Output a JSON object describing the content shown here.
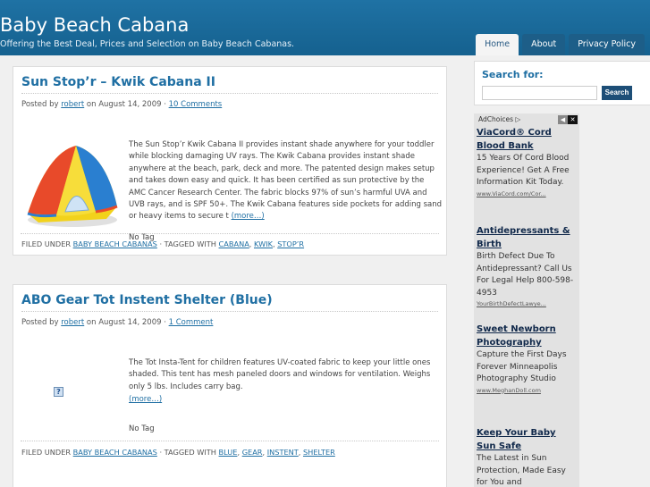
{
  "site": {
    "title": "Baby Beach Cabana",
    "description": "Offering the Best Deal, Prices and Selection on Baby Beach Cabanas."
  },
  "nav": {
    "items": [
      {
        "label": "Home"
      },
      {
        "label": "About"
      },
      {
        "label": "Privacy Policy"
      }
    ]
  },
  "posts": [
    {
      "title": "Sun Stop’r – Kwik Cabana II",
      "posted_by": "Posted by",
      "author": "robert",
      "date": "on August 14, 2009 ·",
      "comments": "10 Comments",
      "body": "The Sun Stop’r Kwik Cabana II provides instant shade anywhere for your toddler while blocking damaging UV rays. The Kwik Cabana provides instant shade anywhere at the beach, park, deck and more. The patented design makes setup and takes down easy and quick. It has been certified as sun protective by the AMC Cancer Research Center. The fabric blocks 97% of sun’s harmful UVA and UVB rays, and is SPF 50+. The Kwik Cabana features side pockets for adding sand or heavy items to secure t",
      "more": "(more…)",
      "no_tag": "No Tag",
      "filed_under": "FILED UNDER",
      "category": "BABY BEACH CABANAS",
      "tagged_with": "· TAGGED WITH",
      "tags": [
        "CABANA",
        "KWIK",
        "STOP’R"
      ]
    },
    {
      "title": "ABO Gear Tot Instent Shelter (Blue)",
      "posted_by": "Posted by",
      "author": "robert",
      "date": "on August 14, 2009 ·",
      "comments": "1 Comment",
      "body": "The Tot Insta-Tent for children features UV-coated fabric to keep your little ones shaded.  This tent has mesh paneled doors and windows for ventilation. Weighs only 5 lbs. Includes carry bag.",
      "more": "(more…)",
      "no_tag": "No Tag",
      "filed_under": "FILED UNDER",
      "category": "BABY BEACH CABANAS",
      "tagged_with": "· TAGGED WITH",
      "tags": [
        "BLUE",
        "GEAR",
        "INSTENT",
        "SHELTER"
      ]
    }
  ],
  "sidebar": {
    "search_label": "Search for:",
    "search_value": "",
    "search_button": "Search",
    "adchoices": "AdChoices",
    "ads": [
      {
        "title": "ViaCord® Cord Blood Bank",
        "text": "15 Years Of Cord Blood Experience! Get A Free Information Kit Today.",
        "url": "www.ViaCord.com/Cor..."
      },
      {
        "title": "Antidepressants & Birth",
        "text": "Birth Defect Due To Antidepressant? Call Us For Legal Help 800-598-4953",
        "url": "YourBirthDefectLawye..."
      },
      {
        "title": "Sweet Newborn Photography",
        "text": "Capture the First Days Forever Minneapolis Photography Studio",
        "url": "www.MeghanDoll.com"
      },
      {
        "title": "Keep Your Baby Sun Safe",
        "text": "The Latest in Sun Protection, Made Easy for You and",
        "url": ""
      }
    ]
  },
  "colors": {
    "header": "#1a6a9a",
    "link": "#1f6fa3",
    "nav_active_bg": "#f4f4f4"
  }
}
